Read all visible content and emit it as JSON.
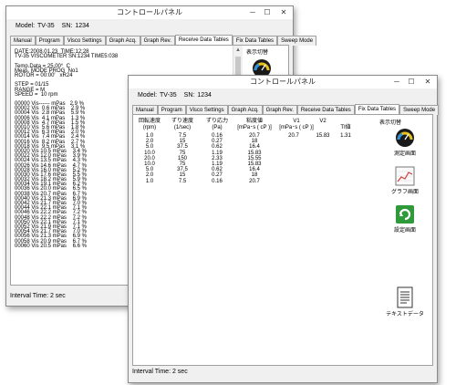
{
  "window_title": "コントロールパネル",
  "model_label": "Model:",
  "model_value": "TV-35",
  "sn_label": "SN:",
  "sn_value": "1234",
  "tabs": [
    "Manual",
    "Program",
    "Visco Settings",
    "Graph Acq.",
    "Graph Rev.",
    "Receive Data Tables",
    "Fix Data Tables",
    "Sweep Mode"
  ],
  "back_window": {
    "active_tab": "Receive Data Tables",
    "text_lines": [
      "DATE:2008.01.23  TIME:12:28",
      "TV-35 VISCOMETER SN:1234 TIME5:038",
      "",
      "Temp.Data = 25.00°  C",
      "Meas. MODE PROG  No1",
      "ROTOR = 00:00'   xR24",
      "",
      "STEP = 01/15",
      "RANGE = M",
      "SPEED =  10 rpm",
      "",
      "00000 Vis------ mPas   2.9 %",
      "00002 Vis  0.6 mPas    2.9 %",
      "00004 Vis  2.8 mPas    5.9 %",
      "00006 Vis  4.1 mPas    1.3 %",
      "00008 Vis  4.7 mPas    1.5 %",
      "00010 Vis  5.6 mPas    1.8 %",
      "00012 Vis  6.3 mPas    2.0 %",
      "00014 Vis  7.4 mPas    2.4 %",
      "00016 Vis  8.2 mPas    2.7 %",
      "00018 Vis  9.5 mPas    3.1 %",
      "00020 Vis 10.5 mPas    3.4 %",
      "00022 Vis 12.0 mPas    3.9 %",
      "00024 Vis 13.5 mPas    4.3 %",
      "00026 Vis 14.6 mPas    4.7 %",
      "00028 Vis 16.0 mPas    5.2 %",
      "00030 Vis 17.6 mPas    5.5 %",
      "00032 Vis 18.2 mPas    5.9 %",
      "00034 Vis 19.1 mPas    6.2 %",
      "00036 Vis 20.0 mPas    6.5 %",
      "00038 Vis 20.7 mPas    6.7 %",
      "00040 Vis 21.3 mPas    6.9 %",
      "00042 Vis 21.7 mPas    7.0 %",
      "00044 Vis 22.1 mPas    7.1 %",
      "00046 Vis 22.2 mPas    7.2 %",
      "00048 Vis 22.2 mPas    7.2 %",
      "00050 Vis 22.1 mPas    7.1 %",
      "00052 Vis 21.9 mPas    7.1 %",
      "00054 Vis 21.7 mPas    7.0 %",
      "00056 Vis 21.3 mPas    6.9 %",
      "00058 Vis 20.9 mPas    6.7 %",
      "00060 Vis 20.5 mPas    6.6 %"
    ],
    "side_label": "表示切替",
    "status": "Interval Time: 2 sec"
  },
  "front_window": {
    "active_tab": "Fix Data Tables",
    "columns": [
      {
        "h1": "回転速度",
        "h2": "(rpm)"
      },
      {
        "h1": "ずり速度",
        "h2": "(1/sec)"
      },
      {
        "h1": "ずり応力",
        "h2": "(Pa)"
      },
      {
        "h1": "粘度値",
        "h2": "[mPa･s ( cP )]"
      },
      {
        "h1": "V1",
        "h2": "[mPa･s ( cP )]"
      },
      {
        "h1": "V2",
        "h2": ""
      },
      {
        "h1": "TI値",
        "h2": ""
      }
    ],
    "rows": [
      [
        "1.0",
        "7.5",
        "0.16",
        "20.7"
      ],
      [
        "2.0",
        "15",
        "0.27",
        "18"
      ],
      [
        "5.0",
        "37.5",
        "0.62",
        "16.4"
      ],
      [
        "10.0",
        "75",
        "1.19",
        "15.83"
      ],
      [
        "20.0",
        "150",
        "2.33",
        "15.55"
      ],
      [
        "10.0",
        "75",
        "1.19",
        "15.83"
      ],
      [
        "5.0",
        "37.5",
        "0.62",
        "16.4"
      ],
      [
        "2.0",
        "15",
        "0.27",
        "18"
      ],
      [
        "1.0",
        "7.5",
        "0.16",
        "20.7"
      ]
    ],
    "v1": "20.7",
    "v2": "15.83",
    "ti": "1.31",
    "side_label": "表示切替",
    "buttons": {
      "meas": "測定画面",
      "graph": "グラフ画面",
      "settings": "設定画面",
      "text": "テキストデータ"
    },
    "status": "Interval Time: 2 sec"
  }
}
